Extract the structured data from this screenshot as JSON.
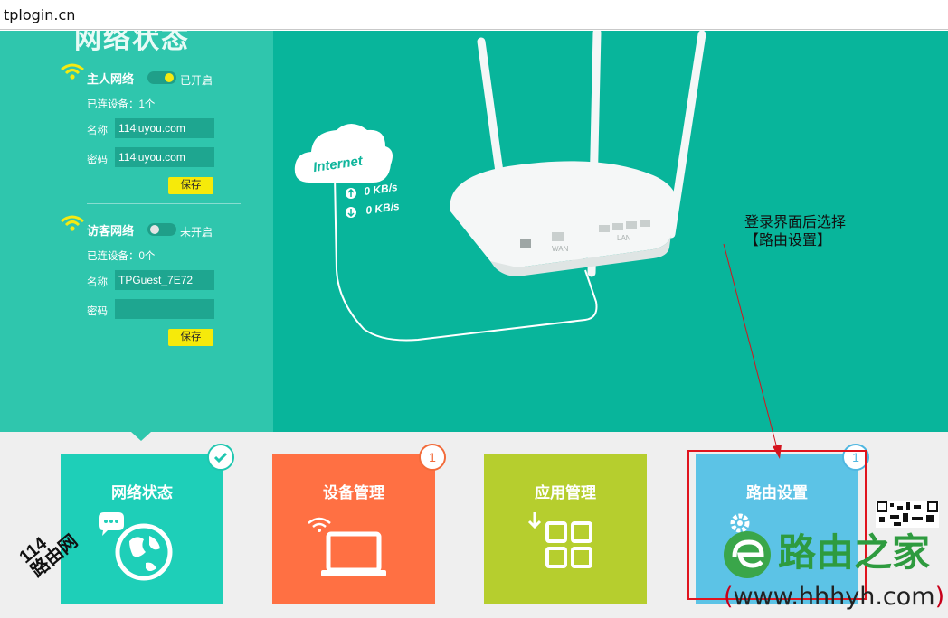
{
  "address_bar": {
    "url": "tplogin.cn"
  },
  "left_panel": {
    "heading": "网络状态",
    "main_network": {
      "title": "主人网络",
      "toggle_state": "已开启",
      "connected": "已连设备：1个",
      "name_label": "名称",
      "name_value": "114luyou.com",
      "password_label": "密码",
      "password_value": "114luyou.com",
      "save_label": "保存"
    },
    "guest_network": {
      "title": "访客网络",
      "toggle_state": "未开启",
      "connected": "已连设备：0个",
      "name_label": "名称",
      "name_value": "TPGuest_7E72",
      "password_label": "密码",
      "password_value": "",
      "save_label": "保存"
    }
  },
  "illustration": {
    "cloud_label": "Internet",
    "upload_speed": "0 KB/s",
    "download_speed": "0 KB/s",
    "port_wan": "WAN",
    "port_lan": "LAN"
  },
  "annotation": {
    "line1": "登录界面后选择",
    "line2": "【路由设置】"
  },
  "tiles": [
    {
      "label": "网络状态",
      "badge": "check",
      "color": "#1ecfb8",
      "badge_color": "#1fc7b0"
    },
    {
      "label": "设备管理",
      "badge": "1",
      "color": "#ff7043",
      "badge_color": "#f26b3a"
    },
    {
      "label": "应用管理",
      "badge": "",
      "color": "#b6ce2e",
      "badge_color": "#b6ce2e"
    },
    {
      "label": "路由设置",
      "badge": "1",
      "color": "#5cc3e6",
      "badge_color": "#4fb7e1"
    }
  ],
  "watermarks": {
    "logo_text": "路由之家",
    "url_open": "(",
    "url": "www.hhhyh.com",
    "url_close": ")",
    "corner_114": "114",
    "corner_text": "路由网"
  },
  "colors": {
    "hero_bg": "#08b59b",
    "panel_bg": "#2fc6ad",
    "save_button": "#f6ea0a",
    "highlight_box": "#e0141e"
  }
}
